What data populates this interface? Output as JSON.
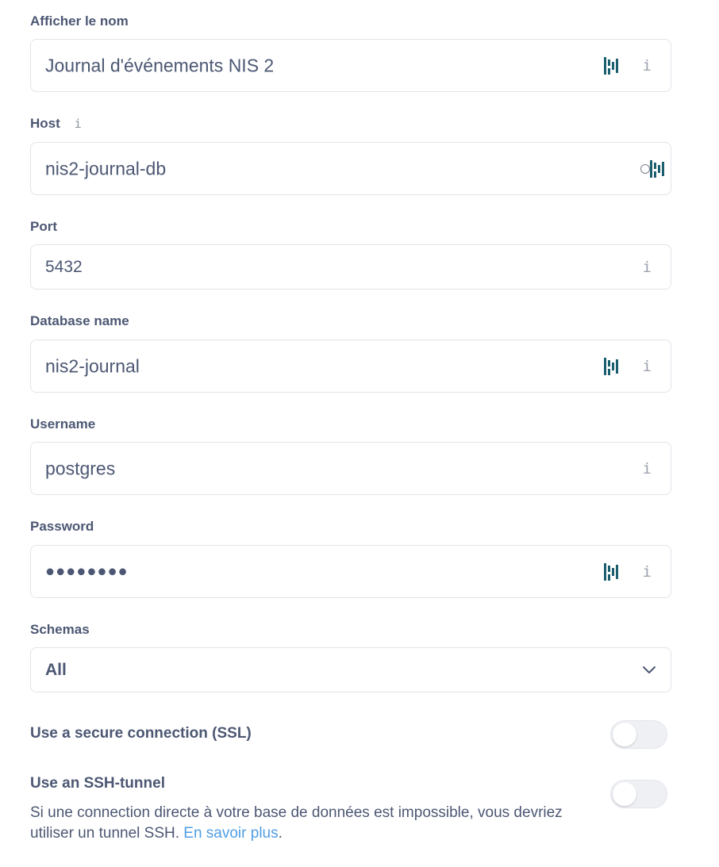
{
  "fields": {
    "display_name": {
      "label": "Afficher le nom",
      "value": "Journal d'événements NIS 2"
    },
    "host": {
      "label": "Host",
      "value": "nis2-journal-db"
    },
    "port": {
      "label": "Port",
      "value": "5432"
    },
    "database_name": {
      "label": "Database name",
      "value": "nis2-journal"
    },
    "username": {
      "label": "Username",
      "value": "postgres"
    },
    "password": {
      "label": "Password",
      "value": "●●●●●●●●"
    },
    "schemas": {
      "label": "Schemas",
      "value": "All"
    }
  },
  "icons": {
    "info": "i",
    "info_glyph_name": "info-icon",
    "password_manager_glyph_name": "password-manager-icon",
    "chevron_glyph_name": "chevron-down-icon"
  },
  "toggles": {
    "ssl": {
      "label": "Use a secure connection (SSL)",
      "on": false
    },
    "ssh": {
      "label": "Use an SSH-tunnel",
      "on": false,
      "description": "Si une connection directe à votre base de données est impossible, vous devriez utiliser un tunnel SSH.",
      "link_text": "En savoir plus",
      "trailing": "."
    }
  },
  "colors": {
    "text": "#4c5773",
    "border": "#e1e4ea",
    "link": "#509ee3",
    "password_manager": "#1b5e6e",
    "toggle_off": "#eef0f4"
  }
}
